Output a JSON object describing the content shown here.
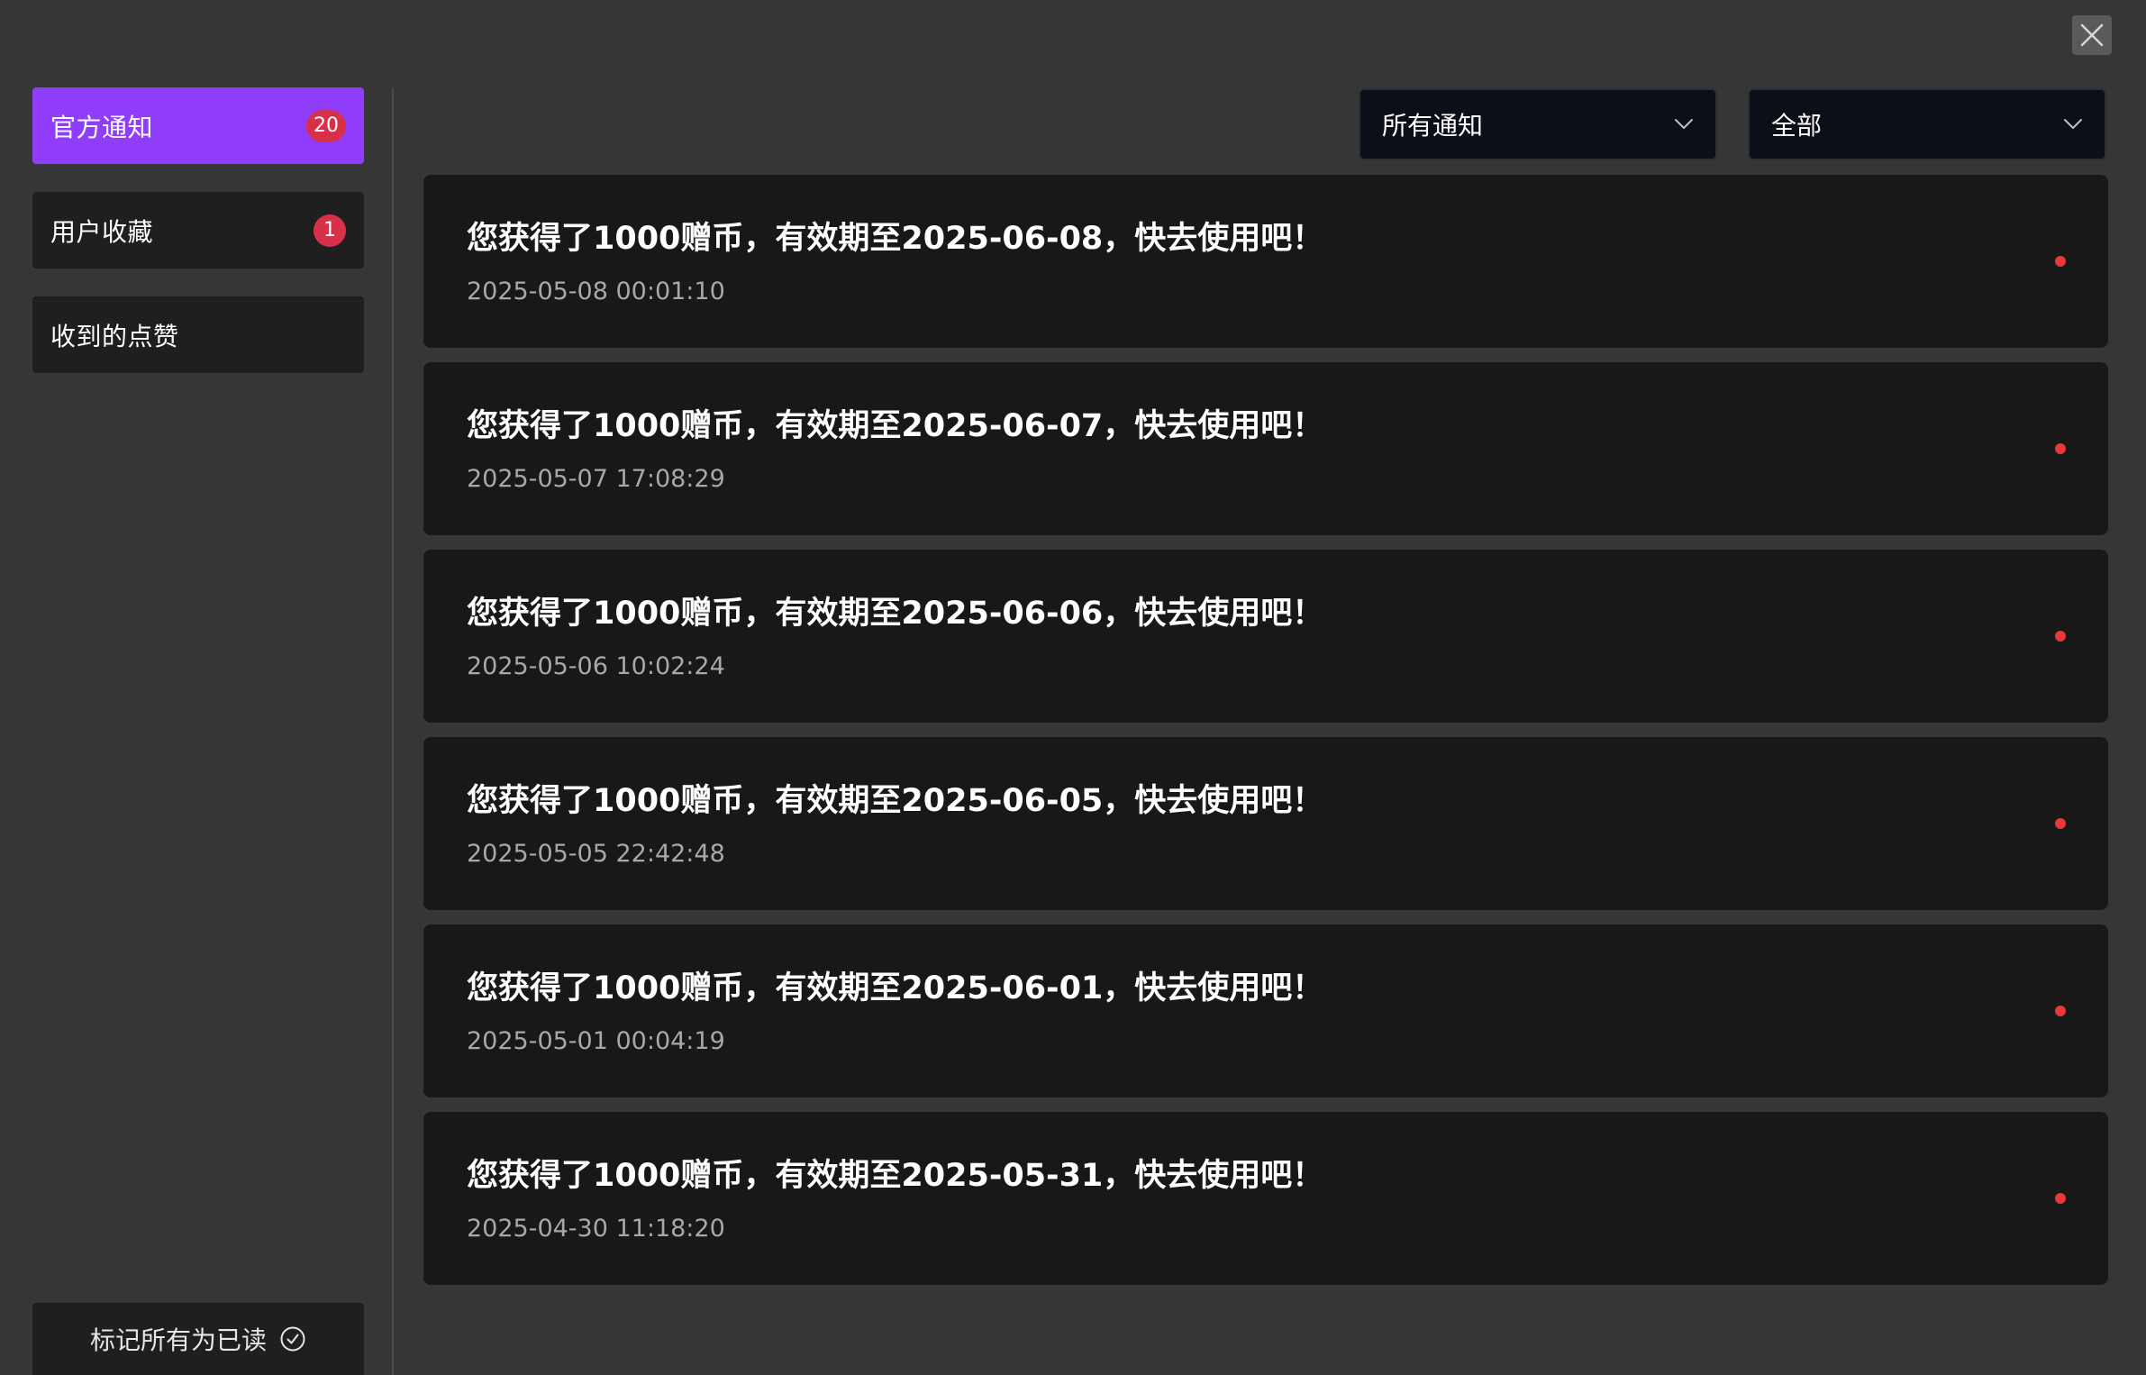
{
  "close_icon": "close-icon",
  "sidebar": {
    "items": [
      {
        "label": "官方通知",
        "badge": "20",
        "active": true
      },
      {
        "label": "用户收藏",
        "badge": "1",
        "active": false
      },
      {
        "label": "收到的点赞",
        "badge": "",
        "active": false
      }
    ],
    "mark_all_read": "标记所有为已读",
    "mark_all_read_icon": "check-circle-icon"
  },
  "filters": {
    "type": {
      "value": "所有通知",
      "icon": "chevron-down-icon"
    },
    "status": {
      "value": "全部",
      "icon": "chevron-down-icon"
    }
  },
  "notifications": [
    {
      "title": "您获得了1000赠币，有效期至2025-06-08，快去使用吧！",
      "time": "2025-05-08 00:01:10",
      "unread": true
    },
    {
      "title": "您获得了1000赠币，有效期至2025-06-07，快去使用吧！",
      "time": "2025-05-07 17:08:29",
      "unread": true
    },
    {
      "title": "您获得了1000赠币，有效期至2025-06-06，快去使用吧！",
      "time": "2025-05-06 10:02:24",
      "unread": true
    },
    {
      "title": "您获得了1000赠币，有效期至2025-06-05，快去使用吧！",
      "time": "2025-05-05 22:42:48",
      "unread": true
    },
    {
      "title": "您获得了1000赠币，有效期至2025-06-01，快去使用吧！",
      "time": "2025-05-01 00:04:19",
      "unread": true
    },
    {
      "title": "您获得了1000赠币，有效期至2025-05-31，快去使用吧！",
      "time": "2025-04-30 11:18:20",
      "unread": true
    }
  ],
  "colors": {
    "background": "#363636",
    "accent": "#8f3dfa",
    "badge": "#d9304a",
    "unread_dot": "#e8383d",
    "card": "#181818"
  }
}
